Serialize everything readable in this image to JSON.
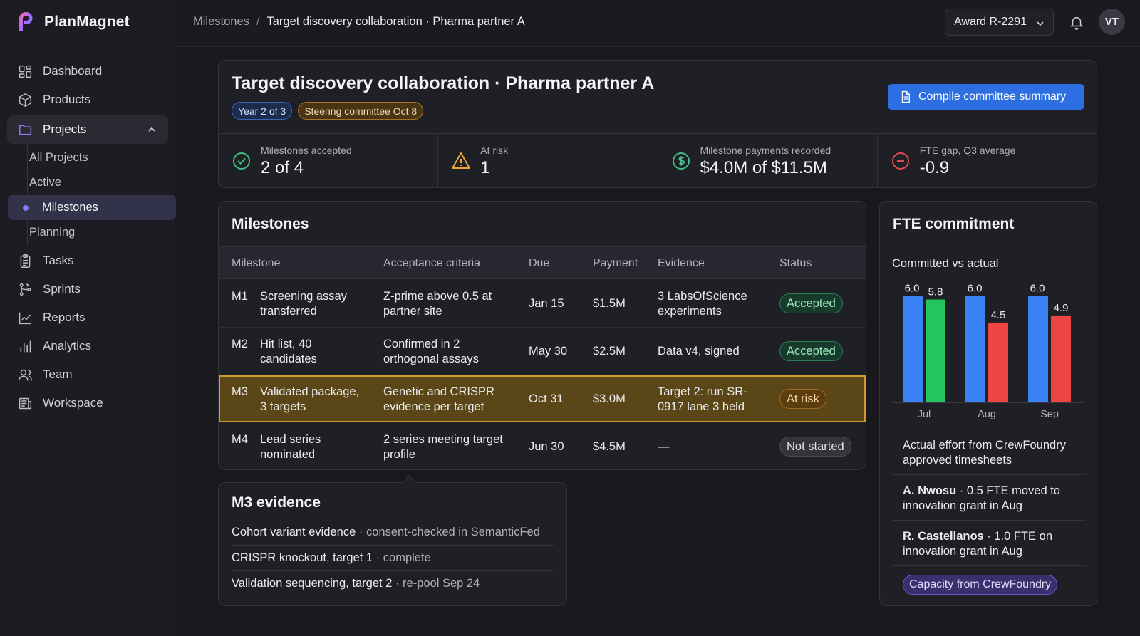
{
  "brand": {
    "name": "PlanMagnet"
  },
  "sidebar": {
    "items": [
      {
        "label": "Dashboard",
        "icon": "dashboard-icon"
      },
      {
        "label": "Products",
        "icon": "box-icon"
      },
      {
        "label": "Projects",
        "icon": "folder-icon"
      },
      {
        "label": "Tasks",
        "icon": "clipboard-icon"
      },
      {
        "label": "Sprints",
        "icon": "git-branch-icon"
      },
      {
        "label": "Reports",
        "icon": "line-chart-icon"
      },
      {
        "label": "Analytics",
        "icon": "bar-chart-icon"
      },
      {
        "label": "Team",
        "icon": "team-icon"
      },
      {
        "label": "Workspace",
        "icon": "workspace-icon"
      }
    ],
    "projects_sub": [
      "All Projects",
      "Active",
      "Milestones",
      "Planning"
    ]
  },
  "topbar": {
    "crumb_root": "Milestones",
    "crumb_sep": "/",
    "crumb_current": "Target discovery collaboration · Pharma partner A",
    "award": "Award R-2291",
    "avatar_initials": "VT"
  },
  "header": {
    "title": "Target discovery collaboration · Pharma partner A",
    "badge_year": "Year 2 of 3",
    "badge_committee": "Steering committee Oct 8",
    "compile_label": "Compile committee summary"
  },
  "kpis": [
    {
      "label": "Milestones accepted",
      "value": "2 of 4",
      "color": "#3fbf7f"
    },
    {
      "label": "At risk",
      "value": "1",
      "color": "#f0a53a"
    },
    {
      "label": "Milestone payments recorded",
      "value": "$4.0M of $11.5M",
      "color": "#3fbf7f"
    },
    {
      "label": "FTE gap, Q3 average",
      "value": "-0.9",
      "color": "#e5484d"
    }
  ],
  "milestones": {
    "title": "Milestones",
    "headers": [
      "Milestone",
      "Acceptance criteria",
      "Due",
      "Payment",
      "Evidence",
      "Status"
    ],
    "rows": [
      {
        "id": "M1",
        "name1": "Screening assay",
        "name2": "transferred",
        "crit1": "Z-prime above 0.5 at",
        "crit2": "partner site",
        "due": "Jan 15",
        "payment": "$1.5M",
        "ev1": "3 LabsOfScience",
        "ev2": "experiments",
        "status": "Accepted"
      },
      {
        "id": "M2",
        "name1": "Hit list, 40",
        "name2": "candidates",
        "crit1": "Confirmed in 2",
        "crit2": "orthogonal assays",
        "due": "May 30",
        "payment": "$2.5M",
        "ev1": "Data v4, signed",
        "ev2": "",
        "status": "Accepted"
      },
      {
        "id": "M3",
        "name1": "Validated package,",
        "name2": "3 targets",
        "crit1": "Genetic and CRISPR",
        "crit2": "evidence per target",
        "due": "Oct 31",
        "payment": "$3.0M",
        "ev1": "Target 2: run SR-",
        "ev2": "0917 lane 3 held",
        "status": "At risk"
      },
      {
        "id": "M4",
        "name1": "Lead series",
        "name2": "nominated",
        "crit1": "2 series meeting target",
        "crit2": "profile",
        "due": "Jun 30",
        "payment": "$4.5M",
        "ev1": "—",
        "ev2": "",
        "status": "Not started"
      }
    ]
  },
  "evidence": {
    "title": "M3 evidence",
    "items": [
      {
        "name": "Cohort variant evidence",
        "note": "· consent-checked in SemanticFed"
      },
      {
        "name": "CRISPR knockout, target 1",
        "note": "· complete"
      },
      {
        "name": "Validation sequencing, target 2",
        "note": "· re-pool Sep 24"
      }
    ]
  },
  "fte": {
    "title": "FTE commitment",
    "subtitle": "Committed vs actual",
    "note1": "Actual effort from CrewFoundry",
    "note2": "approved timesheets",
    "people": [
      {
        "name": "A. Nwosu",
        "l1": " · 0.5 FTE moved to",
        "l2": "innovation grant in Aug"
      },
      {
        "name": "R. Castellanos",
        "l1": " · 1.0 FTE on",
        "l2": "innovation grant in Aug"
      }
    ],
    "capacity_label": "Capacity from CrewFoundry"
  },
  "chart_data": {
    "type": "bar",
    "categories": [
      "Jul",
      "Aug",
      "Sep"
    ],
    "series": [
      {
        "values": [
          6.0,
          6.0,
          6.0
        ],
        "color": "#3b82f6"
      },
      {
        "values": [
          5.8,
          4.5,
          4.9
        ],
        "colors": [
          "#22c55e",
          "#ef4444",
          "#ef4444"
        ]
      }
    ],
    "ylim": [
      0,
      6.5
    ],
    "data_labels": [
      "6.0",
      "5.8",
      "6.0",
      "4.5",
      "6.0",
      "4.9"
    ],
    "grid": false
  }
}
